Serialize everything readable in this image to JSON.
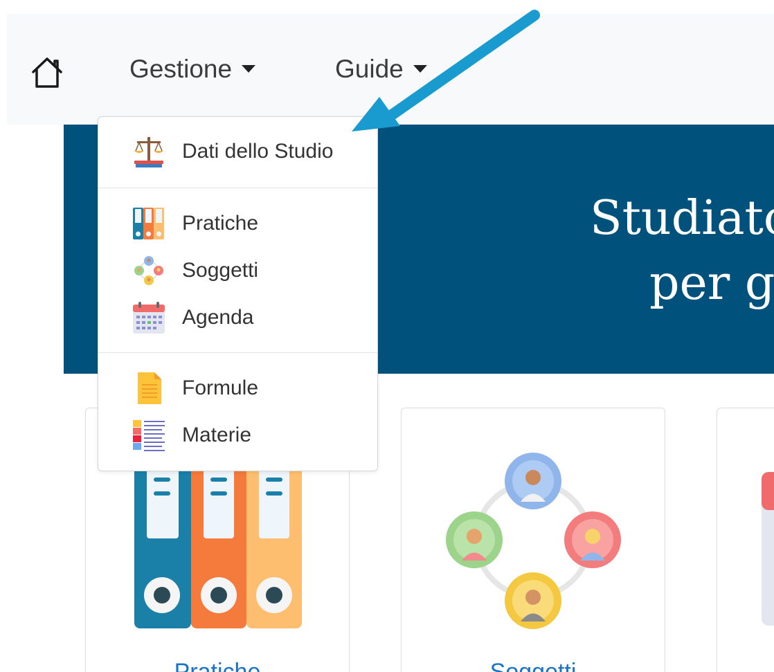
{
  "navbar": {
    "home_icon": "home-icon",
    "items": [
      {
        "label": "Gestione"
      },
      {
        "label": "Guide"
      }
    ]
  },
  "hero": {
    "title_line1": "Studiato",
    "title_line2": "per g"
  },
  "dropdown": {
    "items": [
      {
        "label": "Dati dello Studio",
        "icon": "scales-icon"
      },
      {
        "label": "Pratiche",
        "icon": "binders-icon"
      },
      {
        "label": "Soggetti",
        "icon": "people-network-icon"
      },
      {
        "label": "Agenda",
        "icon": "calendar-icon"
      },
      {
        "label": "Formule",
        "icon": "document-icon"
      },
      {
        "label": "Materie",
        "icon": "list-icon"
      }
    ]
  },
  "cards": [
    {
      "label": "Pratiche",
      "icon": "binders-icon"
    },
    {
      "label": "Soggetti",
      "icon": "people-network-icon"
    }
  ],
  "annotation": {
    "arrow_color": "#1a9bd0"
  },
  "colors": {
    "hero_bg": "#00527c",
    "navbar_bg": "#f8f9fa",
    "link": "#1a73c9"
  }
}
